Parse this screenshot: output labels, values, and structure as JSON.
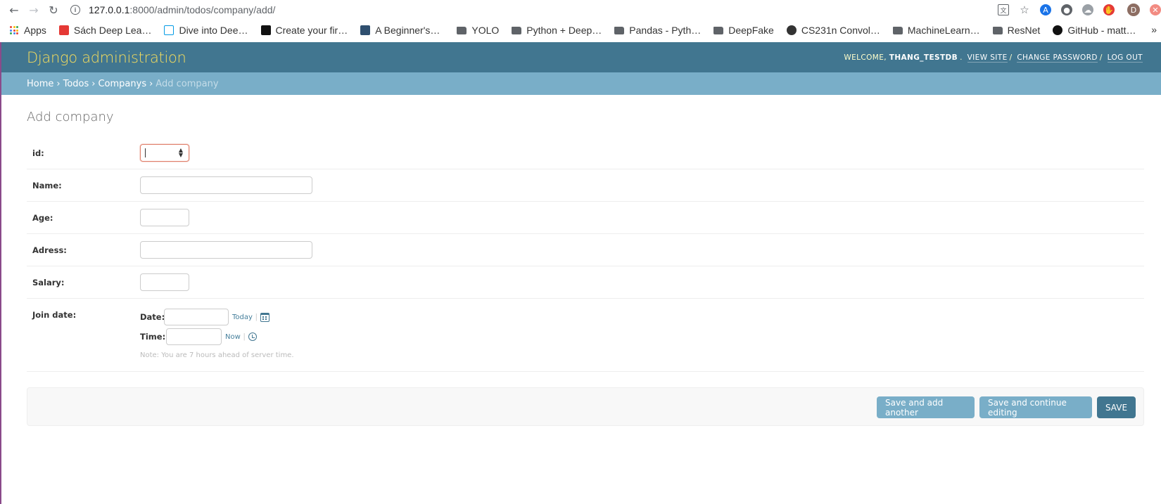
{
  "browser": {
    "url_host": "127.0.0.1",
    "url_path": ":8000/admin/todos/company/add/",
    "bookmarks": [
      {
        "label": "Apps",
        "icon": "apps-grid-icon"
      },
      {
        "label": "Sách Deep Lea…",
        "icon": "pdf-icon"
      },
      {
        "label": "Dive into Dee…",
        "icon": "image-icon"
      },
      {
        "label": "Create your fir…",
        "icon": "medium-icon"
      },
      {
        "label": "A Beginner's…",
        "icon": "page-icon"
      },
      {
        "label": "YOLO",
        "icon": "folder-icon"
      },
      {
        "label": "Python + Deep…",
        "icon": "folder-icon"
      },
      {
        "label": "Pandas - Pyth…",
        "icon": "folder-icon"
      },
      {
        "label": "DeepFake",
        "icon": "folder-icon"
      },
      {
        "label": "CS231n Convol…",
        "icon": "globe-icon"
      },
      {
        "label": "MachineLearn…",
        "icon": "folder-icon"
      },
      {
        "label": "ResNet",
        "icon": "folder-icon"
      },
      {
        "label": "GitHub - matt…",
        "icon": "github-icon"
      }
    ],
    "more_label": "»",
    "profile_initial": "D"
  },
  "header": {
    "branding": "Django administration",
    "welcome": "WELCOME,",
    "username": "THANG_TESTDB",
    "view_site": "VIEW SITE",
    "change_password": "CHANGE PASSWORD",
    "log_out": "LOG OUT"
  },
  "breadcrumbs": {
    "home": "Home",
    "app": "Todos",
    "model": "Companys",
    "current": "Add company",
    "separator": "›"
  },
  "page": {
    "title": "Add company"
  },
  "form": {
    "id_label": "id:",
    "name_label": "Name:",
    "age_label": "Age:",
    "adress_label": "Adress:",
    "salary_label": "Salary:",
    "join_date_label": "Join date:",
    "date_label": "Date:",
    "today_link": "Today",
    "time_label": "Time:",
    "now_link": "Now",
    "note": "Note: You are 7 hours ahead of server time.",
    "pipe": "|"
  },
  "buttons": {
    "save_add_another": "Save and add another",
    "save_continue": "Save and continue editing",
    "save": "SAVE"
  },
  "colors": {
    "header_bg": "#417690",
    "breadcrumbs_bg": "#79aec8",
    "branding": "#f5dd5d",
    "link": "#447e9b"
  }
}
